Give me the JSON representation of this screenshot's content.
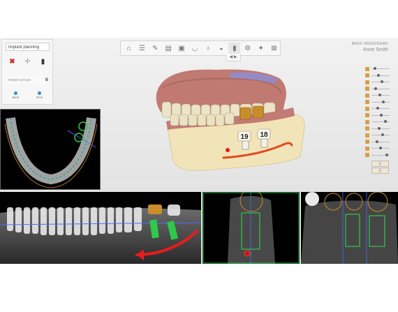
{
  "toolbar": {
    "items": [
      {
        "icon": "home-icon"
      },
      {
        "icon": "workflow-icon"
      },
      {
        "icon": "pen-icon"
      },
      {
        "icon": "layers-icon"
      },
      {
        "icon": "scan-icon"
      },
      {
        "icon": "curve-icon"
      },
      {
        "icon": "tooth-icon"
      },
      {
        "icon": "guide-icon"
      },
      {
        "icon": "implant-icon"
      },
      {
        "icon": "sleeve-icon"
      },
      {
        "icon": "export-icon"
      },
      {
        "icon": "lock-icon"
      }
    ],
    "sub_label": "◀ ▶"
  },
  "patient": {
    "license": "BASIC MODE/DEMO",
    "name": "Anne Smith"
  },
  "left_panel": {
    "title": "Implant planning",
    "tools": [
      {
        "icon": "delete-icon",
        "symbol": "✖",
        "color": "#d22828"
      },
      {
        "icon": "move-icon",
        "symbol": "✛",
        "color": "#999999"
      },
      {
        "icon": "implant-icon",
        "symbol": "▮",
        "color": "#333333"
      }
    ],
    "groups_label": "Implant groups",
    "groups_icon": "tooth-icon",
    "buttons": [
      {
        "label": "Back",
        "icon": "back-icon"
      },
      {
        "label": "Next",
        "icon": "next-icon"
      }
    ]
  },
  "right_panel": {
    "sliders": [
      {
        "icon": "visibility-icon",
        "level": 0.15
      },
      {
        "icon": "jaw-icon",
        "level": 0.35
      },
      {
        "icon": "teeth-icon",
        "level": 0.6
      },
      {
        "icon": "gum-icon",
        "level": 0.2
      },
      {
        "icon": "implant-icon",
        "level": 0.45
      },
      {
        "icon": "nerve-icon",
        "level": 0.7
      },
      {
        "icon": "sleeve-icon",
        "level": 0.3
      },
      {
        "icon": "guide-icon",
        "level": 0.55
      },
      {
        "icon": "bone-icon",
        "level": 0.8
      },
      {
        "icon": "scan-icon",
        "level": 0.4
      },
      {
        "icon": "crown-icon",
        "level": 0.65
      },
      {
        "icon": "model-icon",
        "level": 0.25
      },
      {
        "icon": "opacity-icon",
        "level": 0.5
      },
      {
        "icon": "contrast-icon",
        "level": 0.9
      }
    ],
    "thumbnails": [
      "front-view",
      "side-view",
      "top-view",
      "bottom-view"
    ]
  },
  "model_labels": {
    "implant_a": "19",
    "implant_b": "18"
  },
  "colors": {
    "nerve": "#e24a1e",
    "implant_green": "#2ec94a",
    "crown_gold": "#c98e2a",
    "accent_blue": "#2e8fd6"
  }
}
